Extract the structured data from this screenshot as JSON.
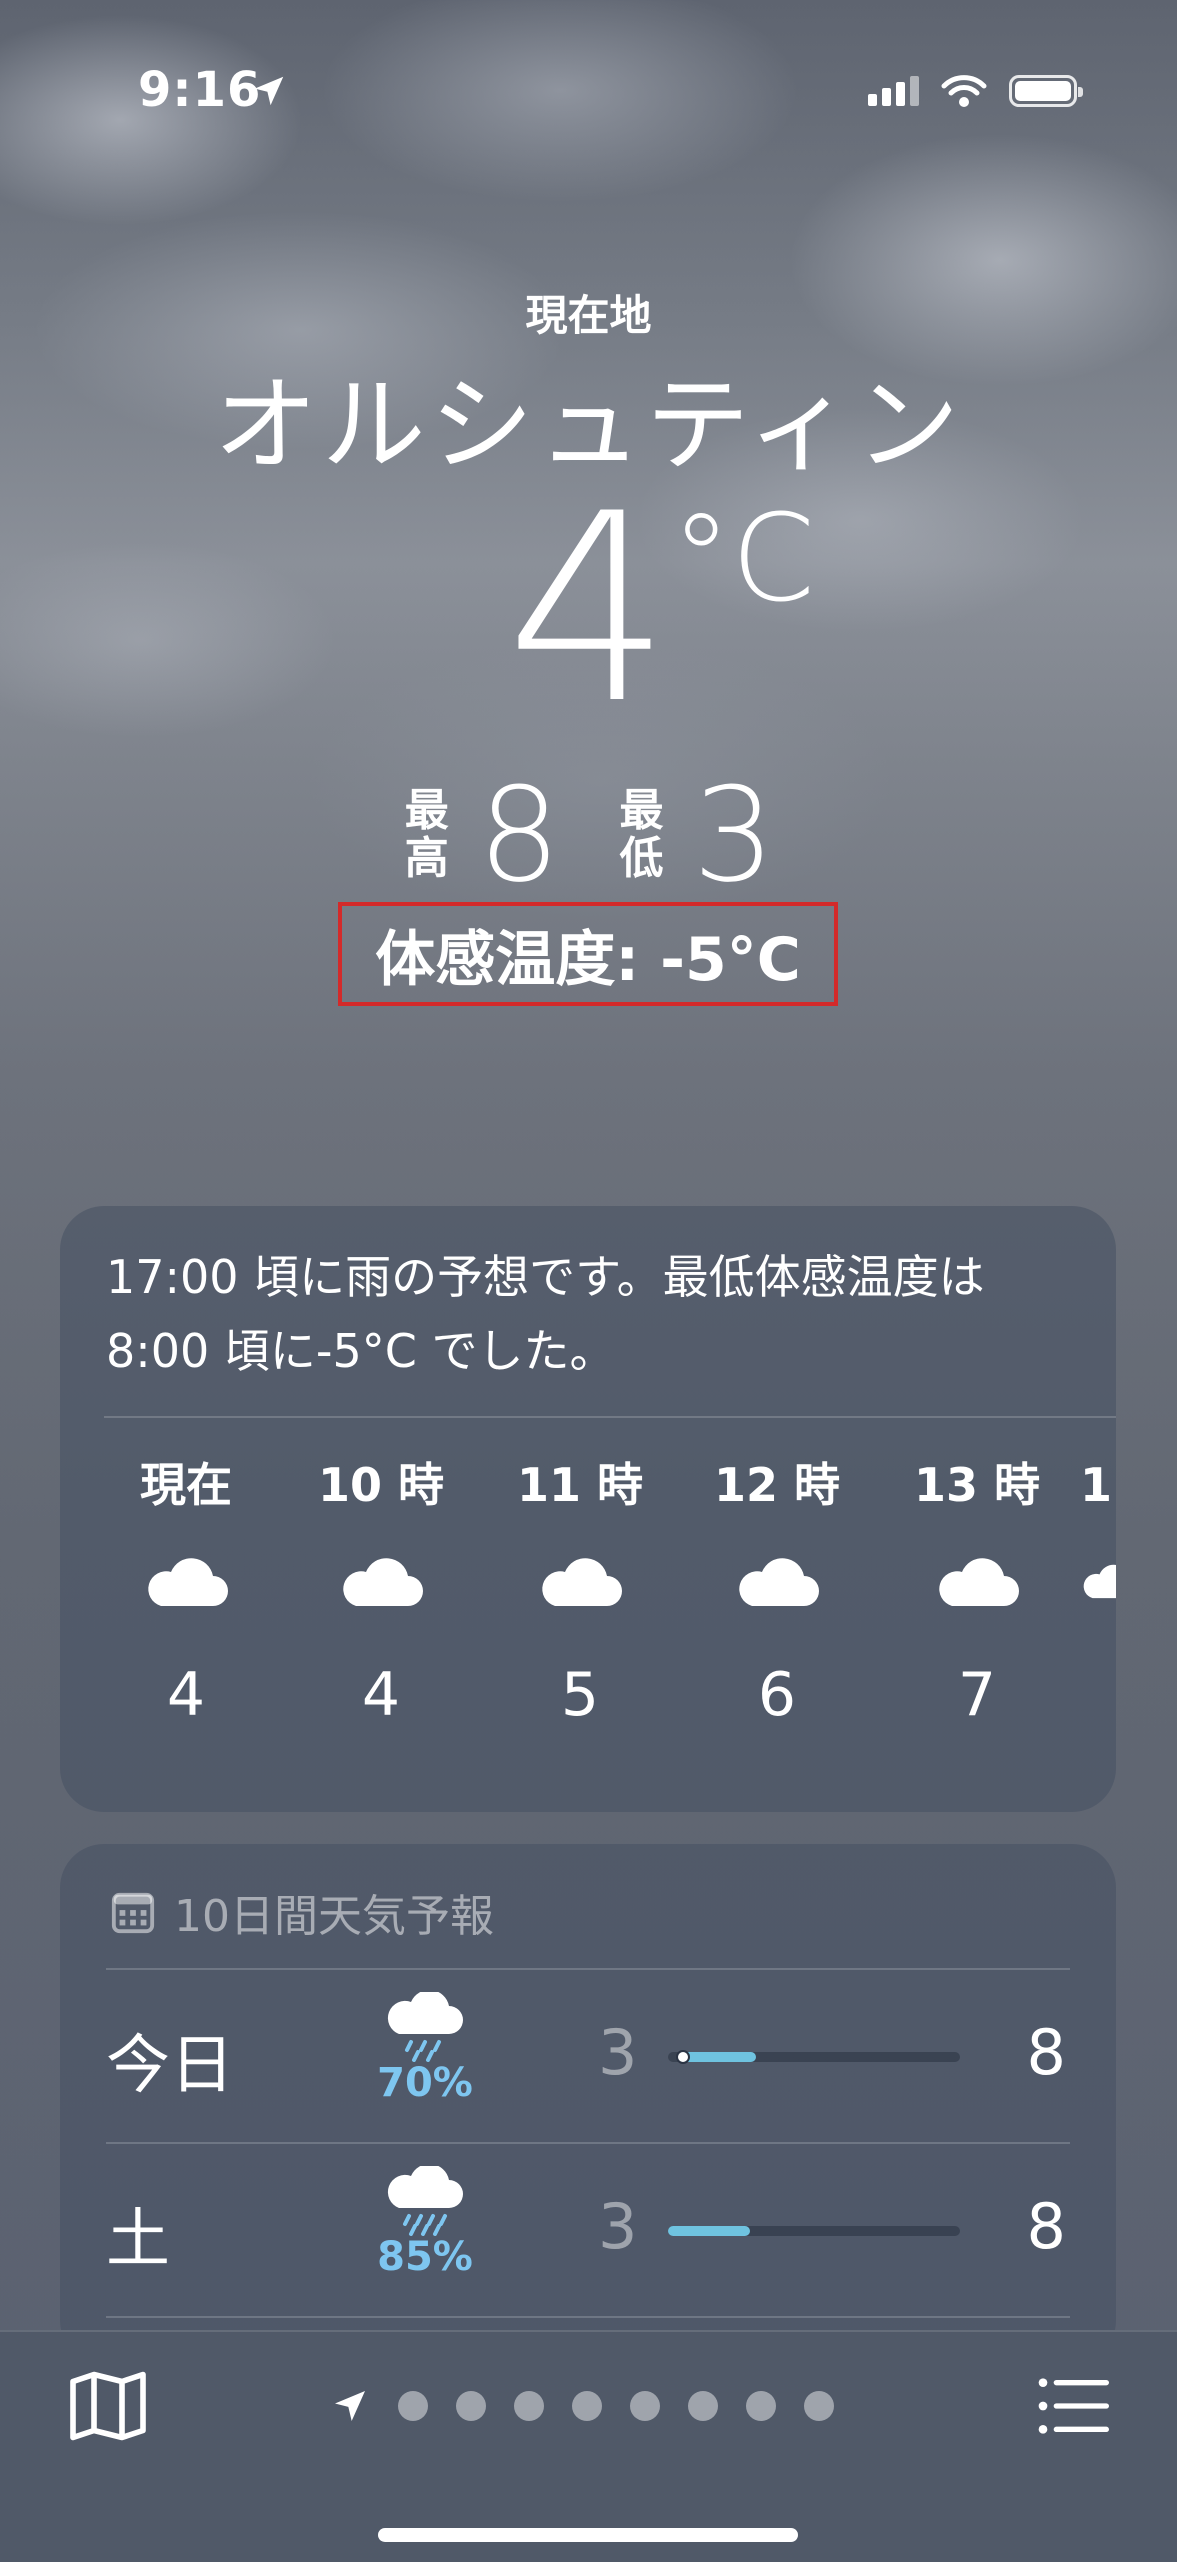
{
  "status_bar": {
    "time": "9:16",
    "location_icon": "location-arrow-icon",
    "signal_icon": "cellular-signal-icon",
    "wifi_icon": "wifi-icon",
    "battery_icon": "battery-icon"
  },
  "header": {
    "location_label": "現在地",
    "city": "オルシュティン",
    "temperature": "4",
    "unit": "°C",
    "high_label_1": "最",
    "high_label_2": "高",
    "high": "8",
    "low_label_1": "最",
    "low_label_2": "低",
    "low": "3",
    "feels_like": "体感温度: -5°C"
  },
  "hourly_card": {
    "summary": "17:00 頃に雨の予想です。最低体感温度は 8:00 頃に-5°C でした。",
    "hours": [
      {
        "label": "現在",
        "icon": "cloud-icon",
        "temp": "4"
      },
      {
        "label": "10 時",
        "icon": "cloud-icon",
        "temp": "4"
      },
      {
        "label": "11 時",
        "icon": "cloud-icon",
        "temp": "5"
      },
      {
        "label": "12 時",
        "icon": "cloud-icon",
        "temp": "6"
      },
      {
        "label": "13 時",
        "icon": "cloud-icon",
        "temp": "7"
      },
      {
        "label": "1",
        "icon": "cloud-icon",
        "temp": ""
      }
    ]
  },
  "forecast_card": {
    "title": "10日間天気予報",
    "title_icon": "calendar-icon",
    "days": [
      {
        "day": "今日",
        "icon": "cloud-rain-icon",
        "precip": "70%",
        "low": "3",
        "high": "8",
        "bar_start": 0.05,
        "bar_end": 0.3,
        "current_marker": 0.05
      },
      {
        "day": "土",
        "icon": "cloud-rain-icon",
        "precip": "85%",
        "low": "3",
        "high": "8",
        "bar_start": 0.0,
        "bar_end": 0.28
      }
    ]
  },
  "bottom_bar": {
    "map_icon": "map-icon",
    "list_icon": "list-icon",
    "page_dots": 8,
    "current_location_icon": "location-arrow-icon"
  },
  "colors": {
    "precip": "#7ec6f0",
    "range_bar": "#6fc3e0",
    "highlight_box": "#d32a2a"
  }
}
